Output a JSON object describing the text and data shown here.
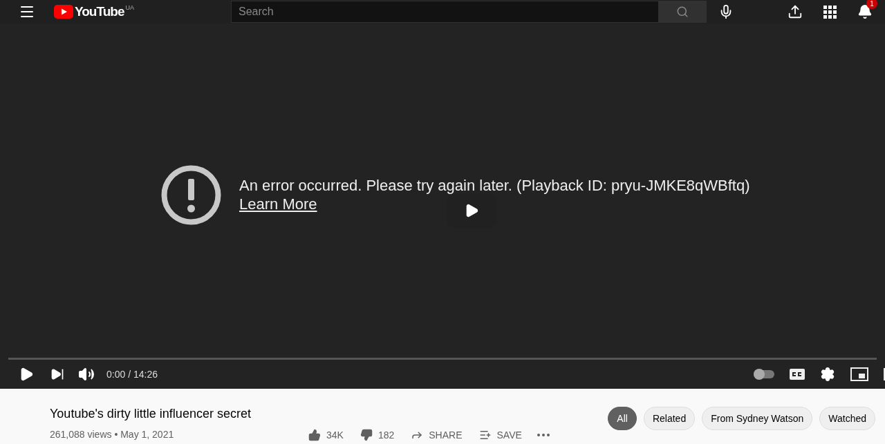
{
  "header": {
    "logo": "YouTube",
    "region": "UA",
    "search": {
      "placeholder": "Search"
    },
    "notifications": "1"
  },
  "player": {
    "error": "An error occurred. Please try again later. (Playback ID: pryu-JMKE8qWBftq)",
    "link": "Learn More",
    "time": "0:00 / 14:26",
    "autoplay": {
      "on": false
    }
  },
  "video": {
    "title": "Youtube's dirty little influencer secret",
    "meta": "261,088 views • May 1, 2021",
    "actions": [
      {
        "kind": "like",
        "label": "34K"
      },
      {
        "kind": "dislike",
        "label": "182"
      },
      {
        "kind": "share",
        "label": "SHARE"
      },
      {
        "kind": "save",
        "label": "SAVE"
      },
      {
        "kind": "more"
      }
    ]
  },
  "chips": [
    {
      "label": "All",
      "selected": true
    },
    {
      "label": "Related",
      "selected": false
    },
    {
      "label": "From Sydney Watson",
      "selected": false
    },
    {
      "label": "Watched",
      "selected": false
    }
  ]
}
